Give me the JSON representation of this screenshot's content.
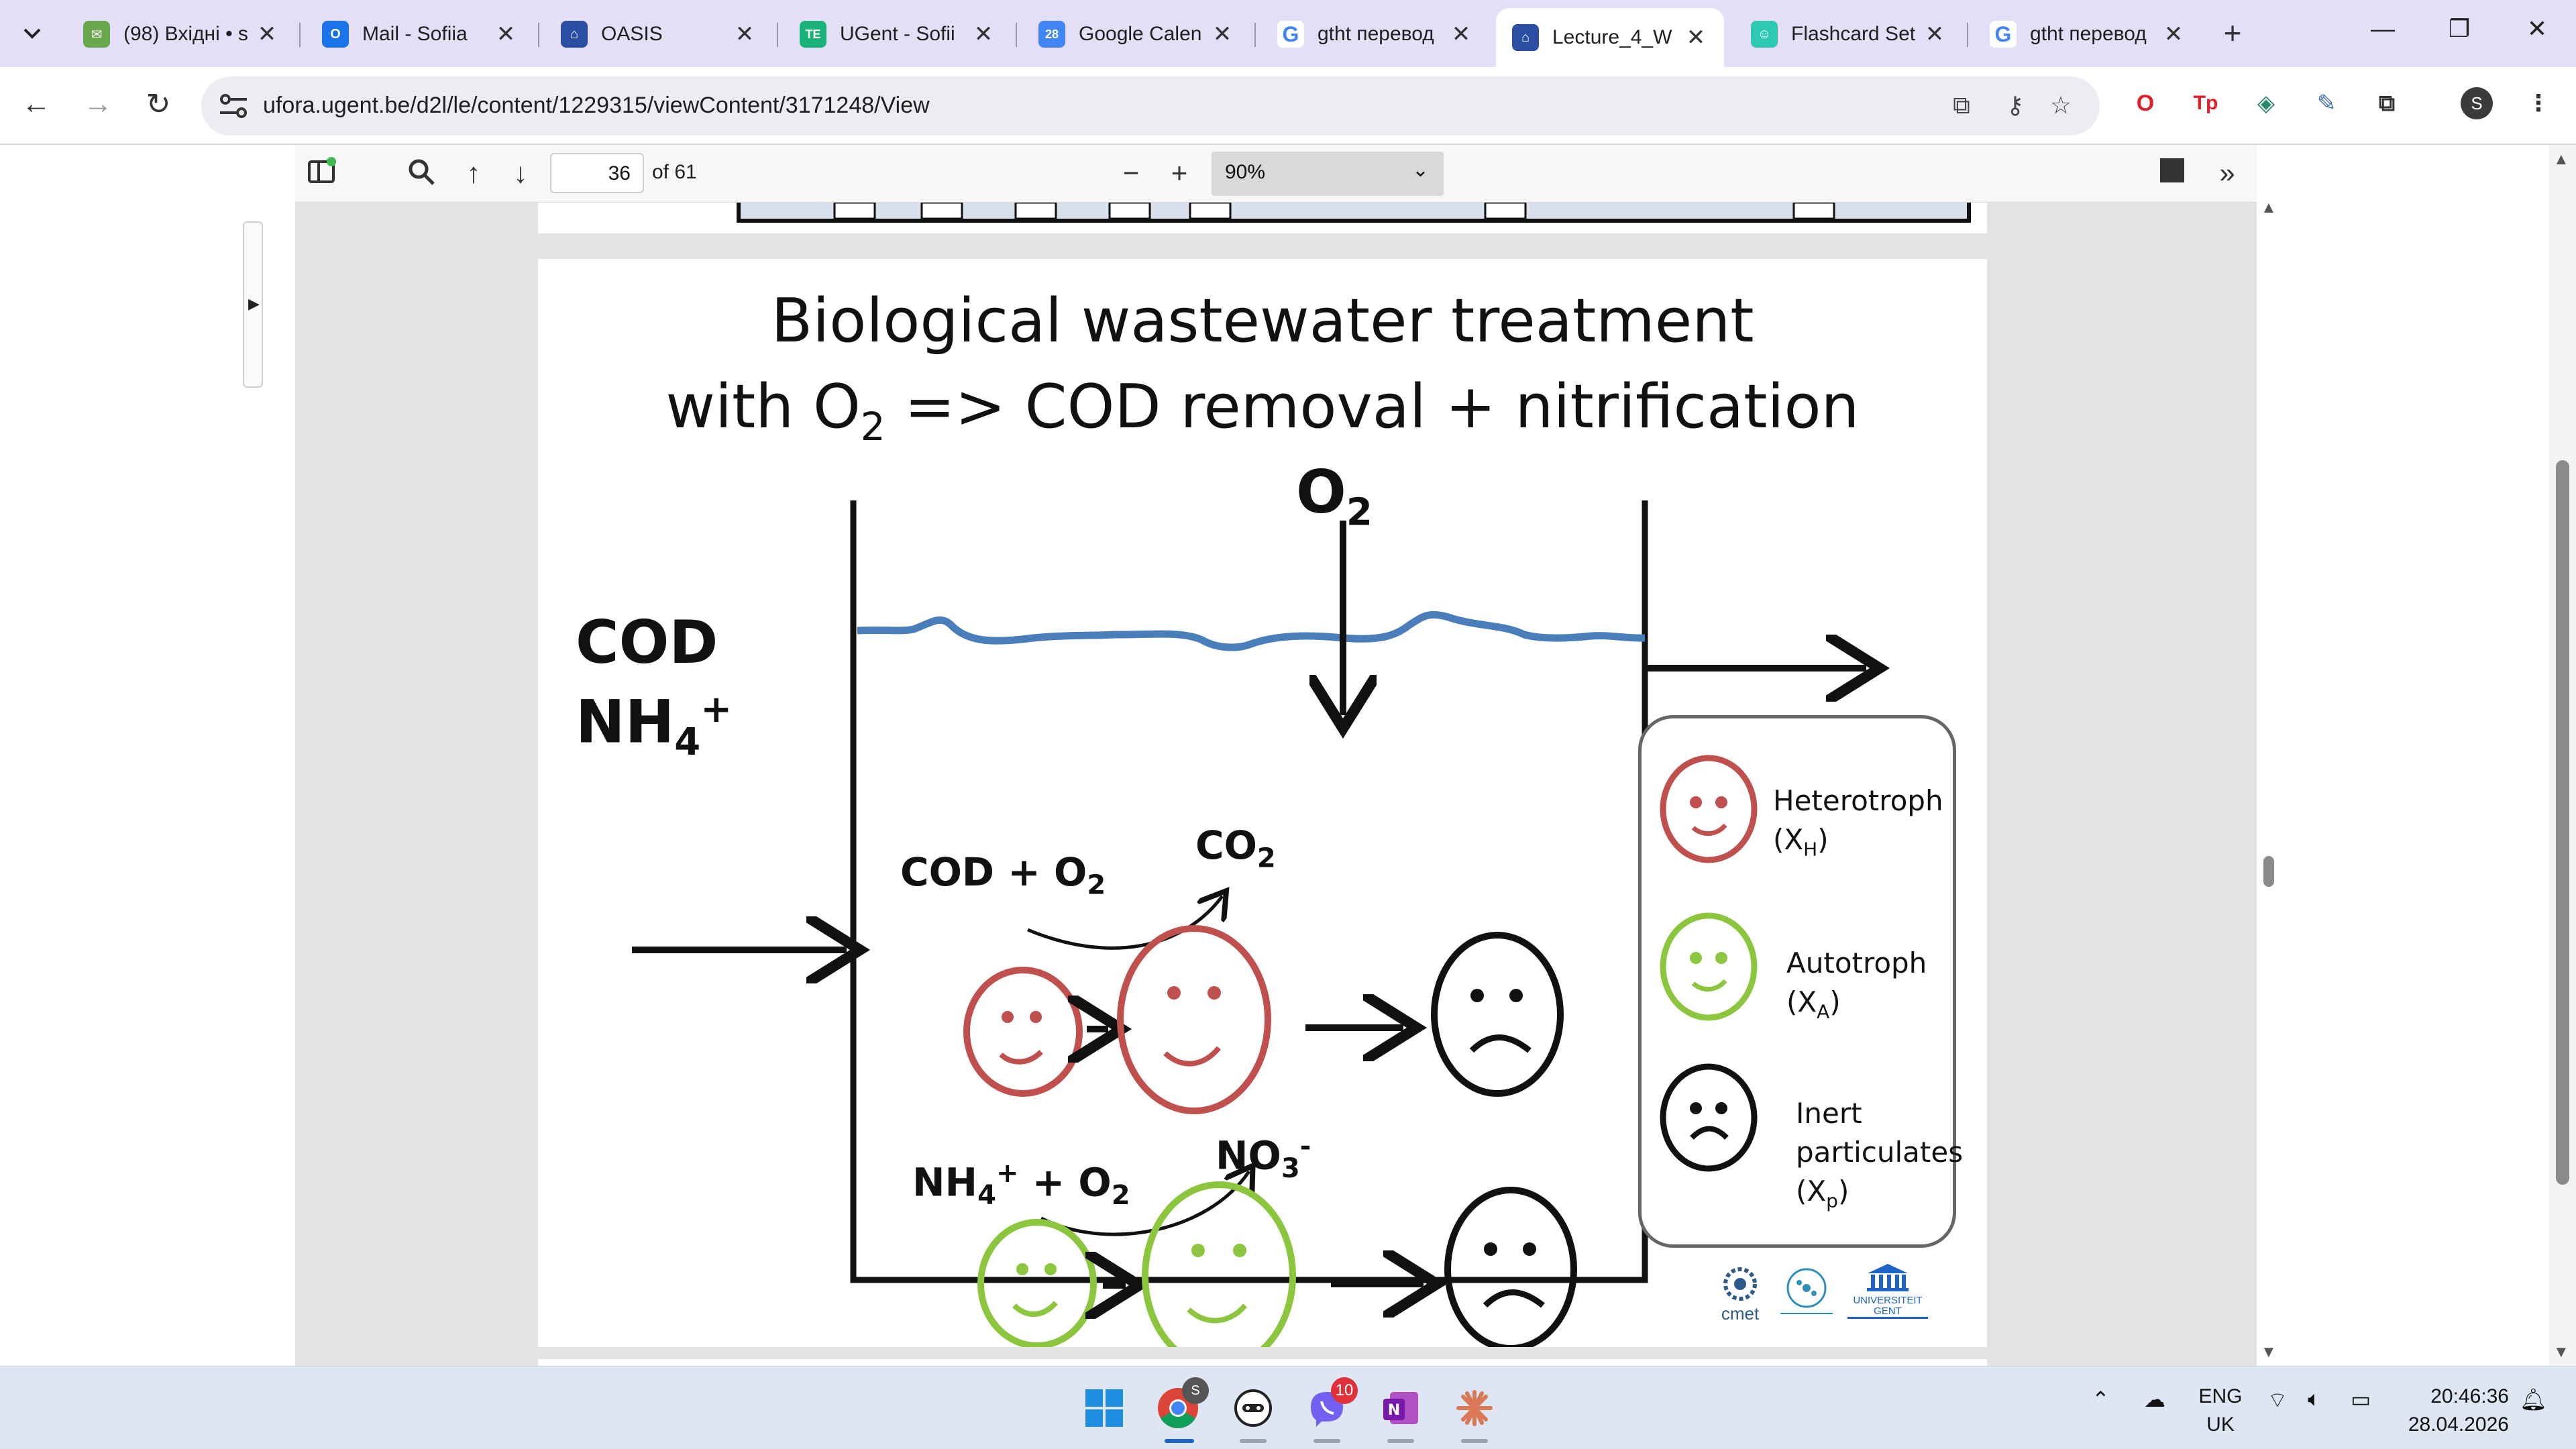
{
  "browser": {
    "tabs": [
      {
        "label": "(98) Вхідні • s",
        "icon": "mail-envelope-icon",
        "color": "#6aa84f",
        "active": false
      },
      {
        "label": "Mail - Sofiia",
        "icon": "outlook-icon",
        "color": "#1a73e8",
        "active": false
      },
      {
        "label": "OASIS",
        "icon": "university-icon",
        "color": "#2b4ea3",
        "active": false
      },
      {
        "label": "UGent - Sofii",
        "icon": "te-icon",
        "color": "#19b37a",
        "active": false
      },
      {
        "label": "Google Calen",
        "icon": "calendar-icon",
        "color": "#4285f4",
        "active": false
      },
      {
        "label": "gtht перевод",
        "icon": "google-icon",
        "color": "#4285f4",
        "active": false
      },
      {
        "label": "Lecture_4_W",
        "icon": "university-icon",
        "color": "#2b4ea3",
        "active": true
      },
      {
        "label": "Flashcard Set",
        "icon": "quizlet-icon",
        "color": "#2dc9b3",
        "active": false
      },
      {
        "label": "gtht перевод",
        "icon": "google-icon",
        "color": "#4285f4",
        "active": false
      }
    ],
    "new_tab_symbol": "+",
    "url": "ufora.ugent.be/d2l/le/content/1229315/viewContent/3171248/View",
    "profile_initial": "S"
  },
  "pdf_toolbar": {
    "page_number": "36",
    "page_total": "of 61",
    "zoom": "90%"
  },
  "slide": {
    "title_line1": "Biological wastewater treatment",
    "title_line2_prefix": "with O",
    "title_line2_sub": "2",
    "title_line2_suffix": " => COD removal + nitrification",
    "inlet_cod": "COD",
    "inlet_nh4": "NH",
    "inlet_nh4_sub": "4",
    "inlet_nh4_sup": "+",
    "o2": "O",
    "o2_sub": "2",
    "reaction1_prefix": "COD + O",
    "reaction1_sub": "2",
    "product1": "CO",
    "product1_sub": "2",
    "reaction2_nh": "NH",
    "reaction2_sub4": "4",
    "reaction2_sup": "+",
    "reaction2_o2": " + O",
    "reaction2_sub2": "2",
    "product2": "NO",
    "product2_sub": "3",
    "product2_sup": "-",
    "legend": {
      "heterotroph": "Heterotroph",
      "heterotroph_sym": "(X",
      "heterotroph_sub": "H",
      "autotroph": "Autotroph",
      "autotroph_sym": "(X",
      "autotroph_sub": "A",
      "inert_line1": "Inert",
      "inert_line2": "particulates",
      "inert_sym": "(X",
      "inert_sub": "p",
      "close": ")"
    },
    "logos": {
      "cmet": "cmet",
      "university_line1": "UNIVERSITEIT",
      "university_line2": "GENT"
    },
    "colors": {
      "heterotroph": "#c0504d",
      "autotroph": "#8cc63f",
      "inert": "#000000",
      "water": "#4a7ebb"
    }
  },
  "taskbar": {
    "viber_badge": "10",
    "chrome_profile_badge": "S",
    "language_line1": "ENG",
    "language_line2": "UK",
    "time": "20:46:36",
    "date": "28.04.2026"
  }
}
